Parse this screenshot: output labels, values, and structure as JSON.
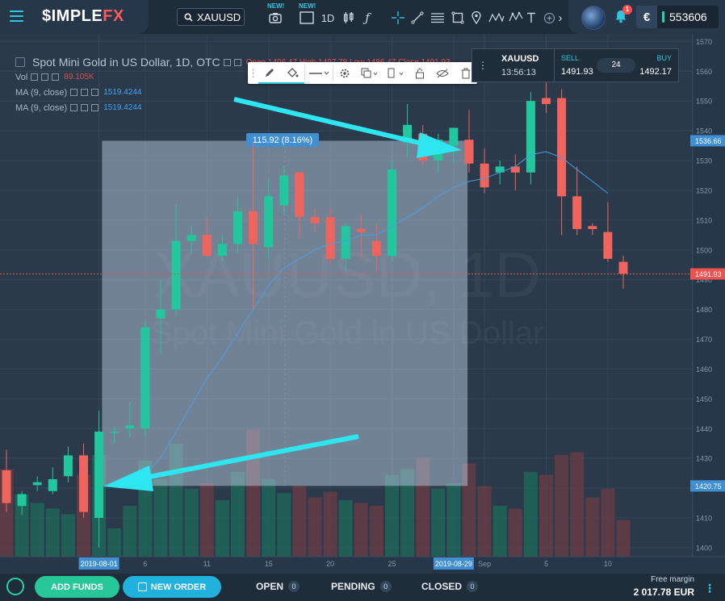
{
  "header": {
    "logo_main": "$IMPLE",
    "logo_accent": "FX",
    "symbol": "XAUUSD",
    "new_badge_1": "NEW!",
    "new_badge_2": "NEW!",
    "timeframe": "1D",
    "balance": "553606",
    "currency_symbol": "€",
    "notifications": "1"
  },
  "legend": {
    "title": "Spot Mini Gold in US Dollar, 1D, OTC",
    "ohlc": "Open 1496.47  High 1497.78  Low 1486.47  Close 1491.93",
    "vol_label": "Vol",
    "vol_value": "89.105K",
    "ma1_label": "MA (9, close)",
    "ma1_value": "1519.4244",
    "ma2_label": "MA (9, close)",
    "ma2_value": "1519.4244"
  },
  "trade_panel": {
    "symbol": "XAUUSD",
    "time": "13:56:13",
    "sell_label": "SELL",
    "sell_price": "1491.93",
    "spread": "24",
    "buy_label": "BUY",
    "buy_price": "1492.17"
  },
  "bottom": {
    "add_funds": "ADD FUNDS",
    "new_order": "NEW ORDER",
    "tabs": [
      {
        "label": "OPEN",
        "count": "0"
      },
      {
        "label": "PENDING",
        "count": "0"
      },
      {
        "label": "CLOSED",
        "count": "0"
      }
    ],
    "free_margin_label": "Free margin",
    "free_margin_value": "2 017.78 EUR"
  },
  "colors": {
    "up": "#22c7a0",
    "down": "#f0645e",
    "accent": "#2fc7e0",
    "background": "#2b3a4b"
  },
  "chart_data": {
    "type": "candlestick",
    "symbol_watermark": "XAUUSD, 1D",
    "name_watermark": "Spot Mini Gold in US Dollar",
    "ylim": [
      1397,
      1572
    ],
    "y_ticks": [
      1400,
      1410,
      1420,
      1430,
      1440,
      1450,
      1460,
      1470,
      1480,
      1490,
      1500,
      1510,
      1520,
      1530,
      1540,
      1550,
      1560,
      1570
    ],
    "x_ticks": [
      {
        "index": 6,
        "label": "2019-08-01",
        "highlight": true
      },
      {
        "index": 9,
        "label": "6"
      },
      {
        "index": 13,
        "label": "11"
      },
      {
        "index": 17,
        "label": "15"
      },
      {
        "index": 21,
        "label": "20"
      },
      {
        "index": 25,
        "label": "25"
      },
      {
        "index": 29,
        "label": "2019-08-29",
        "highlight": true
      },
      {
        "index": 31,
        "label": "Sep"
      },
      {
        "index": 35,
        "label": "5"
      },
      {
        "index": 39,
        "label": "10"
      }
    ],
    "current_price": 1491.93,
    "crosshair_price": "1536.66",
    "crosshair_price2": "1420.75",
    "measure_label": "115.92 (8.16%)",
    "measure_box": {
      "i0": 6.2,
      "i1": 29.9,
      "p0": 1536.66,
      "p1": 1420.75
    },
    "candles": [
      {
        "o": 1426,
        "h": 1433,
        "l": 1412,
        "c": 1415,
        "v": 0.62
      },
      {
        "o": 1414,
        "h": 1419,
        "l": 1411,
        "c": 1418,
        "v": 0.44
      },
      {
        "o": 1421,
        "h": 1424,
        "l": 1419,
        "c": 1422,
        "v": 0.38
      },
      {
        "o": 1419,
        "h": 1427,
        "l": 1418,
        "c": 1423,
        "v": 0.34
      },
      {
        "o": 1424,
        "h": 1434,
        "l": 1422,
        "c": 1431,
        "v": 0.3
      },
      {
        "o": 1431,
        "h": 1435,
        "l": 1410,
        "c": 1412,
        "v": 0.58
      },
      {
        "o": 1410,
        "h": 1446,
        "l": 1400,
        "c": 1439,
        "v": 0.72
      },
      {
        "o": 1439,
        "h": 1441,
        "l": 1435,
        "c": 1439,
        "v": 0.2
      },
      {
        "o": 1440,
        "h": 1449,
        "l": 1437,
        "c": 1441,
        "v": 0.36
      },
      {
        "o": 1440,
        "h": 1476,
        "l": 1437,
        "c": 1474,
        "v": 0.68
      },
      {
        "o": 1477,
        "h": 1490,
        "l": 1465,
        "c": 1480,
        "v": 0.55
      },
      {
        "o": 1480,
        "h": 1515,
        "l": 1478,
        "c": 1503,
        "v": 0.8
      },
      {
        "o": 1503,
        "h": 1508,
        "l": 1499,
        "c": 1505,
        "v": 0.48
      },
      {
        "o": 1505,
        "h": 1511,
        "l": 1498,
        "c": 1498,
        "v": 0.52
      },
      {
        "o": 1498,
        "h": 1505,
        "l": 1496,
        "c": 1502,
        "v": 0.4
      },
      {
        "o": 1502,
        "h": 1518,
        "l": 1499,
        "c": 1513,
        "v": 0.6
      },
      {
        "o": 1513,
        "h": 1536,
        "l": 1480,
        "c": 1502,
        "v": 0.9
      },
      {
        "o": 1501,
        "h": 1524,
        "l": 1497,
        "c": 1518,
        "v": 0.55
      },
      {
        "o": 1515,
        "h": 1528,
        "l": 1512,
        "c": 1525,
        "v": 0.45
      },
      {
        "o": 1526,
        "h": 1526,
        "l": 1504,
        "c": 1511,
        "v": 0.5
      },
      {
        "o": 1511,
        "h": 1514,
        "l": 1506,
        "c": 1509,
        "v": 0.42
      },
      {
        "o": 1511,
        "h": 1514,
        "l": 1495,
        "c": 1497,
        "v": 0.46
      },
      {
        "o": 1497,
        "h": 1509,
        "l": 1493,
        "c": 1508,
        "v": 0.4
      },
      {
        "o": 1507,
        "h": 1512,
        "l": 1497,
        "c": 1506,
        "v": 0.38
      },
      {
        "o": 1503,
        "h": 1509,
        "l": 1493,
        "c": 1498,
        "v": 0.36
      },
      {
        "o": 1498,
        "h": 1530,
        "l": 1496,
        "c": 1527,
        "v": 0.58
      },
      {
        "o": 1536,
        "h": 1549,
        "l": 1531,
        "c": 1542,
        "v": 0.62
      },
      {
        "o": 1539,
        "h": 1542,
        "l": 1528,
        "c": 1530,
        "v": 0.7
      },
      {
        "o": 1530,
        "h": 1539,
        "l": 1526,
        "c": 1537,
        "v": 0.48
      },
      {
        "o": 1535,
        "h": 1541,
        "l": 1529,
        "c": 1541,
        "v": 0.52
      },
      {
        "o": 1537,
        "h": 1547,
        "l": 1526,
        "c": 1529,
        "v": 0.66
      },
      {
        "o": 1529,
        "h": 1534,
        "l": 1519,
        "c": 1521,
        "v": 0.5
      },
      {
        "o": 1526,
        "h": 1530,
        "l": 1522,
        "c": 1528,
        "v": 0.36
      },
      {
        "o": 1528,
        "h": 1532,
        "l": 1520,
        "c": 1526,
        "v": 0.34
      },
      {
        "o": 1526,
        "h": 1553,
        "l": 1522,
        "c": 1550,
        "v": 0.6
      },
      {
        "o": 1551,
        "h": 1557,
        "l": 1546,
        "c": 1549,
        "v": 0.58
      },
      {
        "o": 1551,
        "h": 1554,
        "l": 1505,
        "c": 1518,
        "v": 0.72
      },
      {
        "o": 1518,
        "h": 1528,
        "l": 1505,
        "c": 1507,
        "v": 0.74
      },
      {
        "o": 1508,
        "h": 1509,
        "l": 1505,
        "c": 1507,
        "v": 0.42
      },
      {
        "o": 1506,
        "h": 1516,
        "l": 1496,
        "c": 1497,
        "v": 0.48
      },
      {
        "o": 1496,
        "h": 1498,
        "l": 1487,
        "c": 1492,
        "v": 0.26
      }
    ],
    "ma": [
      null,
      null,
      null,
      null,
      null,
      null,
      null,
      null,
      1421,
      1425,
      1430,
      1439,
      1448,
      1457,
      1464,
      1472,
      1480,
      1488,
      1494,
      1497,
      1500,
      1502,
      1503,
      1505,
      1505,
      1508,
      1511,
      1514,
      1518,
      1521,
      1523,
      1524,
      1526,
      1528,
      1532,
      1533,
      1531,
      1527,
      1523,
      1519,
      null
    ]
  }
}
